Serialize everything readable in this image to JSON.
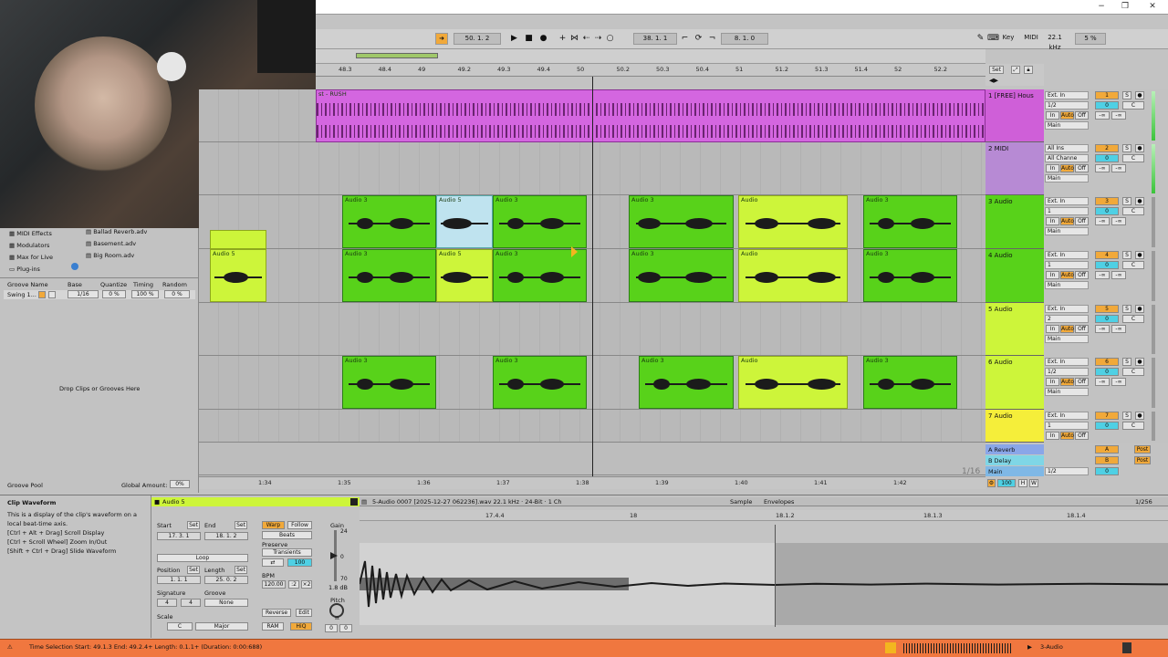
{
  "window": {
    "minimize": "−",
    "maximize": "❐",
    "close": "✕"
  },
  "transport": {
    "follow_icon": "follow-icon",
    "tempo_pos": "50. 1. 2",
    "arr_pos": "38. 1. 1",
    "loop_len": "8. 1. 0",
    "key_label": "Key",
    "midi_label": "MIDI",
    "sample_rate": "22.1 kHz",
    "cpu": "5 %"
  },
  "ruler": {
    "bars": [
      "48.3",
      "48.4",
      "49",
      "49.2",
      "49.3",
      "49.4",
      "50",
      "50.2",
      "50.3",
      "50.4",
      "51",
      "51.2",
      "51.3",
      "51.4",
      "52",
      "52.2"
    ],
    "set_label": "Set",
    "times": [
      "1:34",
      "1:35",
      "1:36",
      "1:37",
      "1:38",
      "1:39",
      "1:40",
      "1:41",
      "1:42"
    ],
    "zoom_ratio": "1/16"
  },
  "browser": {
    "categories": [
      "MIDI Effects",
      "Modulators",
      "Max for Live",
      "Plug-ins"
    ],
    "files": [
      "Ballad Reverb.adv",
      "Basement.adv",
      "Big Room.adv"
    ]
  },
  "groove": {
    "headers": [
      "Groove Name",
      "Base",
      "Quantize",
      "Timing",
      "Random"
    ],
    "row": {
      "name": "Swing 1...",
      "base": "1/16",
      "quantize": "0 %",
      "timing": "100 %",
      "random": "0 %"
    },
    "drop_text": "Drop Clips or Grooves Here",
    "pool_label": "Groove Pool",
    "global_amount_label": "Global Amount:",
    "global_amount": "0%"
  },
  "tracks": [
    {
      "num": "1",
      "name": "1 [FREE] Hous",
      "input": "Ext. In",
      "ch": "1/2",
      "out": "Main",
      "vol": "0",
      "pan": "C",
      "send": "-∞",
      "color": "#cf5fd8"
    },
    {
      "num": "2",
      "name": "2 MIDI",
      "input": "All Ins",
      "ch": "All Channe",
      "out": "Main",
      "vol": "0",
      "pan": "C",
      "send": "-∞",
      "color": "#b78ad4"
    },
    {
      "num": "3",
      "name": "3 Audio",
      "input": "Ext. In",
      "ch": "1",
      "out": "Main",
      "vol": "0",
      "pan": "C",
      "send": "-∞",
      "color": "#58d21a"
    },
    {
      "num": "4",
      "name": "4 Audio",
      "input": "Ext. In",
      "ch": "1",
      "out": "Main",
      "vol": "0",
      "pan": "C",
      "send": "-∞",
      "color": "#58d21a"
    },
    {
      "num": "5",
      "name": "5 Audio",
      "input": "Ext. In",
      "ch": "2",
      "out": "Main",
      "vol": "0",
      "pan": "C",
      "send": "-∞",
      "color": "#cdf53a"
    },
    {
      "num": "6",
      "name": "6 Audio",
      "input": "Ext. In",
      "ch": "1/2",
      "out": "Main",
      "vol": "0",
      "pan": "C",
      "send": "-∞",
      "color": "#cdf53a"
    },
    {
      "num": "7",
      "name": "7 Audio",
      "input": "Ext. In",
      "ch": "1",
      "out": "Main",
      "vol": "0",
      "pan": "C",
      "send": "-∞",
      "color": "#f5ee3a"
    }
  ],
  "returns": [
    {
      "name": "A Reverb",
      "letter": "A",
      "post": "Post"
    },
    {
      "name": "B Delay",
      "letter": "B",
      "post": "Post"
    },
    {
      "name": "Main",
      "letter": "",
      "post": "",
      "ch": "1/2",
      "vol": "0"
    }
  ],
  "clip_names": {
    "track1": "st - RUSH",
    "audio3": "Audio 3",
    "audio5": "Audio 5",
    "audio": "Audio"
  },
  "clip_view": {
    "panel_title": "Clip Waveform",
    "help_lines": [
      "This is a display of the clip's waveform on a local beat-time axis.",
      "[Ctrl + Alt + Drag] Scroll Display",
      "[Ctrl + Scroll Wheel] Zoom In/Out",
      "[Shift + Ctrl + Drag] Slide Waveform"
    ],
    "clip_name": "Audio 5",
    "file_info": "5-Audio 0007 [2025-12-27 062236].wav  22.1 kHz · 24-Bit · 1 Ch",
    "tab_sample": "Sample",
    "tab_envelopes": "Envelopes",
    "page": "1/256",
    "start_label": "Start",
    "end_label": "End",
    "set_label": "Set",
    "start_val": "17. 3. 1",
    "end_val": "18. 1. 2",
    "loop_label": "Loop",
    "position_label": "Position",
    "length_label": "Length",
    "position_val": "1. 1. 1",
    "length_val": "25. 0. 2",
    "signature_label": "Signature",
    "sig_num": "4",
    "sig_den": "4",
    "groove_label": "Groove",
    "groove_val": "None",
    "scale_label": "Scale",
    "scale_root": "C",
    "scale_mode": "Major",
    "warp_label": "Warp",
    "follow_label": "Follow",
    "beats_label": "Beats",
    "preserve_label": "Preserve",
    "transients_label": "Transients",
    "transient_val": "100",
    "bpm_label": "BPM",
    "bpm_val": "120.00",
    "half": ":2",
    "double": "×2",
    "reverse_label": "Reverse",
    "edit_label": "Edit",
    "ram_label": "RAM",
    "hiq_label": "HiQ",
    "gain_label": "Gain",
    "gain_top": "24",
    "gain_mid": "0",
    "gain_bot": "70",
    "gain_val": "1.8 dB",
    "pitch_label": "Pitch",
    "pitch_st": "st",
    "pitch_val": "0",
    "pitch_cents": "0",
    "ruler": [
      "17.4.4",
      "18",
      "18.1.2",
      "18.1.3",
      "18.1.4"
    ]
  },
  "status": {
    "text": "Time Selection  Start: 49.1.3  End: 49.2.4+  Length: 0.1.1+ (Duration: 0:00:688)",
    "track_label": "3-Audio"
  }
}
